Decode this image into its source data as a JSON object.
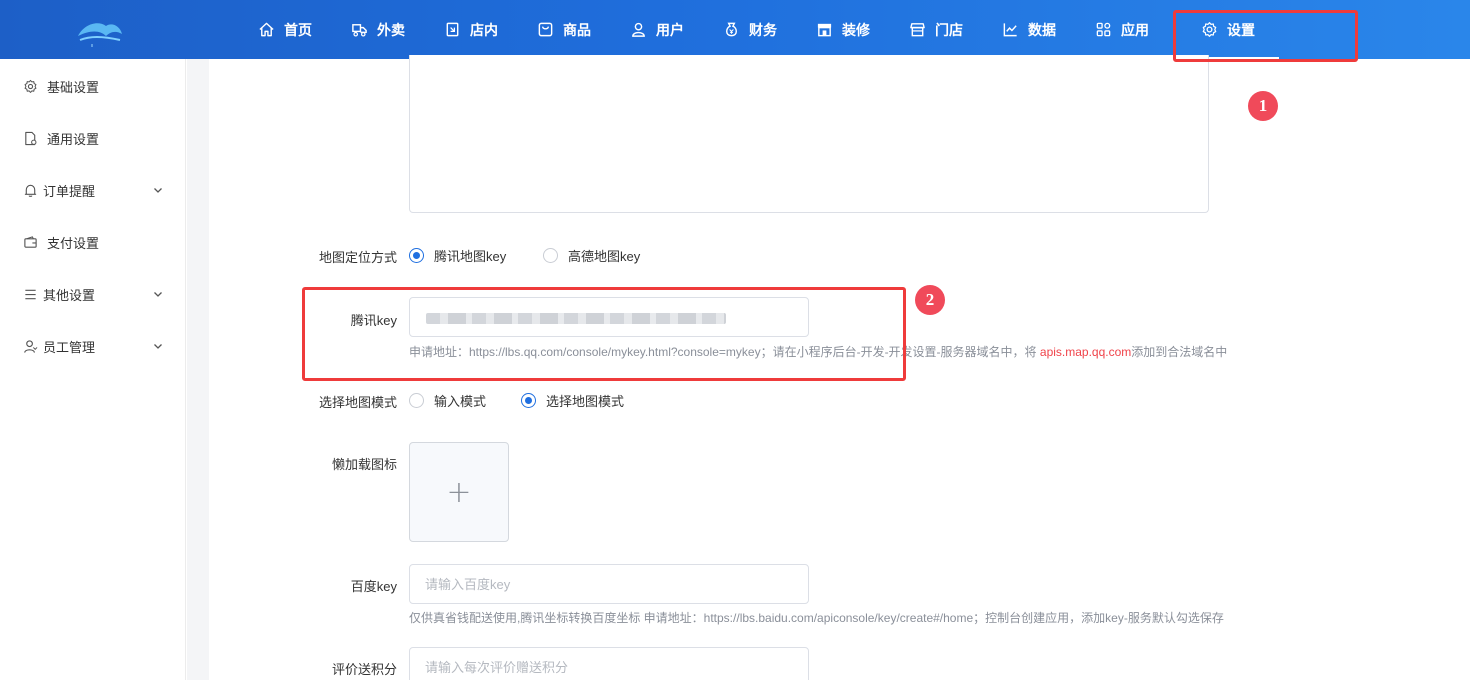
{
  "nav": {
    "items": [
      {
        "label": "首页",
        "icon": "home-icon"
      },
      {
        "label": "外卖",
        "icon": "delivery-icon"
      },
      {
        "label": "店内",
        "icon": "dine-in-icon"
      },
      {
        "label": "商品",
        "icon": "product-icon"
      },
      {
        "label": "用户",
        "icon": "user-icon"
      },
      {
        "label": "财务",
        "icon": "finance-icon"
      },
      {
        "label": "装修",
        "icon": "decorate-icon"
      },
      {
        "label": "门店",
        "icon": "store-icon"
      },
      {
        "label": "数据",
        "icon": "chart-icon"
      },
      {
        "label": "应用",
        "icon": "apps-icon"
      },
      {
        "label": "设置",
        "icon": "gear-icon"
      }
    ],
    "active": "设置"
  },
  "sidebar": {
    "items": [
      {
        "label": "基础设置",
        "icon": "gear-icon",
        "expandable": false
      },
      {
        "label": "通用设置",
        "icon": "document-icon",
        "expandable": false
      },
      {
        "label": "订单提醒",
        "icon": "bell-icon",
        "expandable": true
      },
      {
        "label": "支付设置",
        "icon": "wallet-icon",
        "expandable": false
      },
      {
        "label": "其他设置",
        "icon": "menu-icon",
        "expandable": true
      },
      {
        "label": "员工管理",
        "icon": "person-icon",
        "expandable": true
      }
    ]
  },
  "form": {
    "map_mode": {
      "label": "地图定位方式",
      "options": [
        "腾讯地图key",
        "高德地图key"
      ],
      "selected": "腾讯地图key"
    },
    "tencent_key": {
      "label": "腾讯key",
      "hint_prefix": "申请地址：https://lbs.qq.com/console/mykey.html?console=mykey；请在小程序后台-开发-开发设置-服务器域名中，将 ",
      "hint_link": "apis.map.qq.com",
      "hint_suffix": "添加到合法域名中"
    },
    "select_mode": {
      "label": "选择地图模式",
      "options": [
        "输入模式",
        "选择地图模式"
      ],
      "selected": "选择地图模式"
    },
    "lazy_icon": {
      "label": "懒加载图标",
      "upload_symbol": "+"
    },
    "baidu_key": {
      "label": "百度key",
      "placeholder": "请输入百度key",
      "hint": "仅供真省钱配送使用,腾讯坐标转换百度坐标 申请地址：https://lbs.baidu.com/apiconsole/key/create#/home；控制台创建应用，添加key-服务默认勾选保存"
    },
    "review_points": {
      "label": "评价送积分",
      "placeholder": "请输入每次评价赠送积分"
    }
  },
  "annotations": [
    {
      "number": "1"
    },
    {
      "number": "2"
    }
  ],
  "colors": {
    "primary": "#1f6fe0",
    "annotation": "#ef3b3b",
    "link": "#f0434a"
  }
}
